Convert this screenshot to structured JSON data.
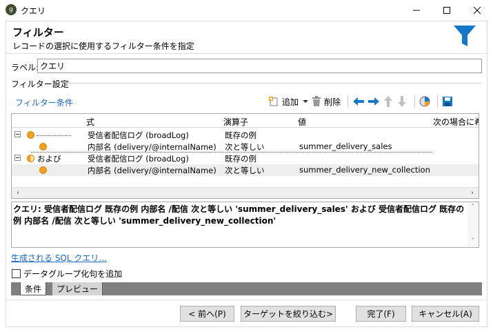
{
  "window": {
    "title": "クエリ",
    "icon_glyph": "g"
  },
  "header": {
    "title": "フィルター",
    "subtitle": "レコードの選択に使用するフィルター条件を指定",
    "accent_color": "#1478c8"
  },
  "label_field": {
    "label": "ラベル:",
    "value": "クエリ"
  },
  "filter_settings": {
    "group_title": "フィルター設定",
    "conditions_title": "フィルター条件",
    "toolbar": {
      "add_label": "追加",
      "delete_label": "削除"
    },
    "columns": [
      "式",
      "演算子",
      "値",
      "次の場合に希"
    ],
    "rows": [
      {
        "prefix": "",
        "expression": "受信者配信ログ (broadLog)",
        "operator": "既存の例",
        "value": ""
      },
      {
        "prefix": "",
        "expression": "内部名 (delivery/@internalName)",
        "operator": "次と等しい",
        "value": "summer_delivery_sales"
      },
      {
        "prefix": "および",
        "expression": "受信者配信ログ (broadLog)",
        "operator": "既存の例",
        "value": ""
      },
      {
        "prefix": "",
        "expression": "内部名 (delivery/@internalName)",
        "operator": "次と等しい",
        "value": "summer_delivery_new_collection"
      }
    ]
  },
  "query_summary": "クエリ: 受信者配信ログ 既存の例 内部名 /配信 次と等しい 'summer_delivery_sales' および 受信者配信ログ 既存の例 内部名 /配信 次と等しい 'summer_delivery_new_collection'",
  "sql_link": "生成される SQL クエリ...",
  "data_grouping_checkbox": {
    "label": "データグループ化句を追加",
    "checked": false
  },
  "tabs": [
    "条件",
    "プレビュー"
  ],
  "buttons": {
    "back": "< 前へ(P)",
    "narrow": "ターゲットを絞り込む>",
    "finish": "完了(F)",
    "cancel": "キャンセル(A)"
  }
}
